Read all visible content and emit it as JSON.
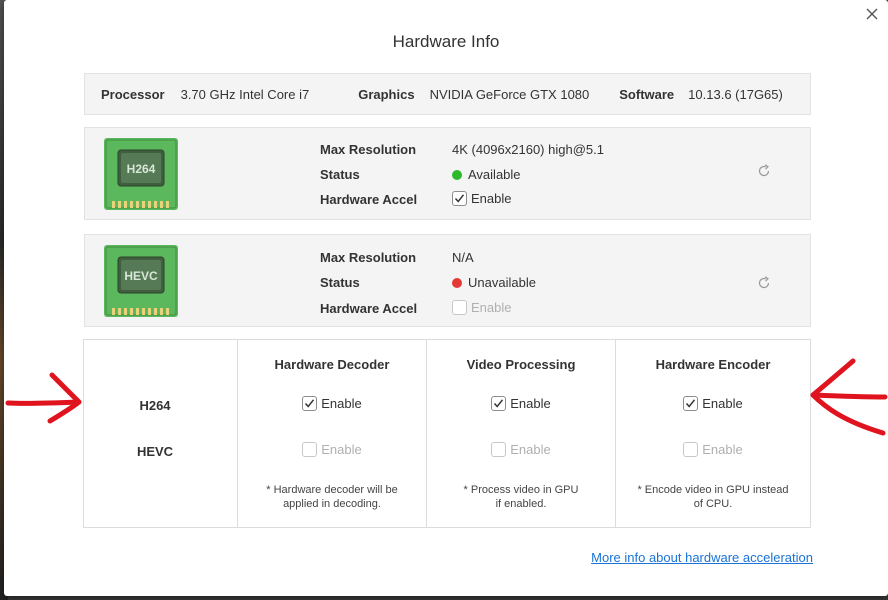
{
  "dialog": {
    "title": "Hardware Info",
    "more_info_link": "More info about hardware acceleration"
  },
  "system": {
    "processor_label": "Processor",
    "processor_value": "3.70 GHz Intel Core i7",
    "graphics_label": "Graphics",
    "graphics_value": "NVIDIA GeForce GTX 1080",
    "software_label": "Software",
    "software_value": "10.13.6 (17G65)"
  },
  "codecs": [
    {
      "chip_label": "H264",
      "max_resolution_label": "Max Resolution",
      "max_resolution_value": "4K (4096x2160) high@5.1",
      "status_label": "Status",
      "status_value": "Available",
      "status_color": "#2eb82e",
      "accel_label": "Hardware Accel",
      "accel_option": "Enable",
      "accel_checked": true,
      "accel_disabled": false
    },
    {
      "chip_label": "HEVC",
      "max_resolution_label": "Max Resolution",
      "max_resolution_value": "N/A",
      "status_label": "Status",
      "status_value": "Unavailable",
      "status_color": "#e53935",
      "accel_label": "Hardware Accel",
      "accel_option": "Enable",
      "accel_checked": false,
      "accel_disabled": true
    }
  ],
  "matrix": {
    "rows": [
      "H264",
      "HEVC"
    ],
    "columns": [
      {
        "header": "Hardware Decoder",
        "cells": [
          {
            "label": "Enable",
            "checked": true,
            "disabled": false
          },
          {
            "label": "Enable",
            "checked": false,
            "disabled": true
          }
        ],
        "note_line1": "* Hardware decoder will be",
        "note_line2": "applied in decoding."
      },
      {
        "header": "Video Processing",
        "cells": [
          {
            "label": "Enable",
            "checked": true,
            "disabled": false
          },
          {
            "label": "Enable",
            "checked": false,
            "disabled": true
          }
        ],
        "note_line1": "* Process video in GPU",
        "note_line2": "if enabled."
      },
      {
        "header": "Hardware Encoder",
        "cells": [
          {
            "label": "Enable",
            "checked": true,
            "disabled": false
          },
          {
            "label": "Enable",
            "checked": false,
            "disabled": true
          }
        ],
        "note_line1": "* Encode video in GPU instead",
        "note_line2": "of CPU."
      }
    ]
  },
  "icons": {
    "close": "close-icon",
    "refresh": "refresh-icon",
    "chip": "chip-icon",
    "checkmark": "checkmark-icon"
  },
  "colors": {
    "chip_green": "#5cb85c",
    "link_blue": "#1a73d9",
    "annotation_red": "#e0141e"
  }
}
